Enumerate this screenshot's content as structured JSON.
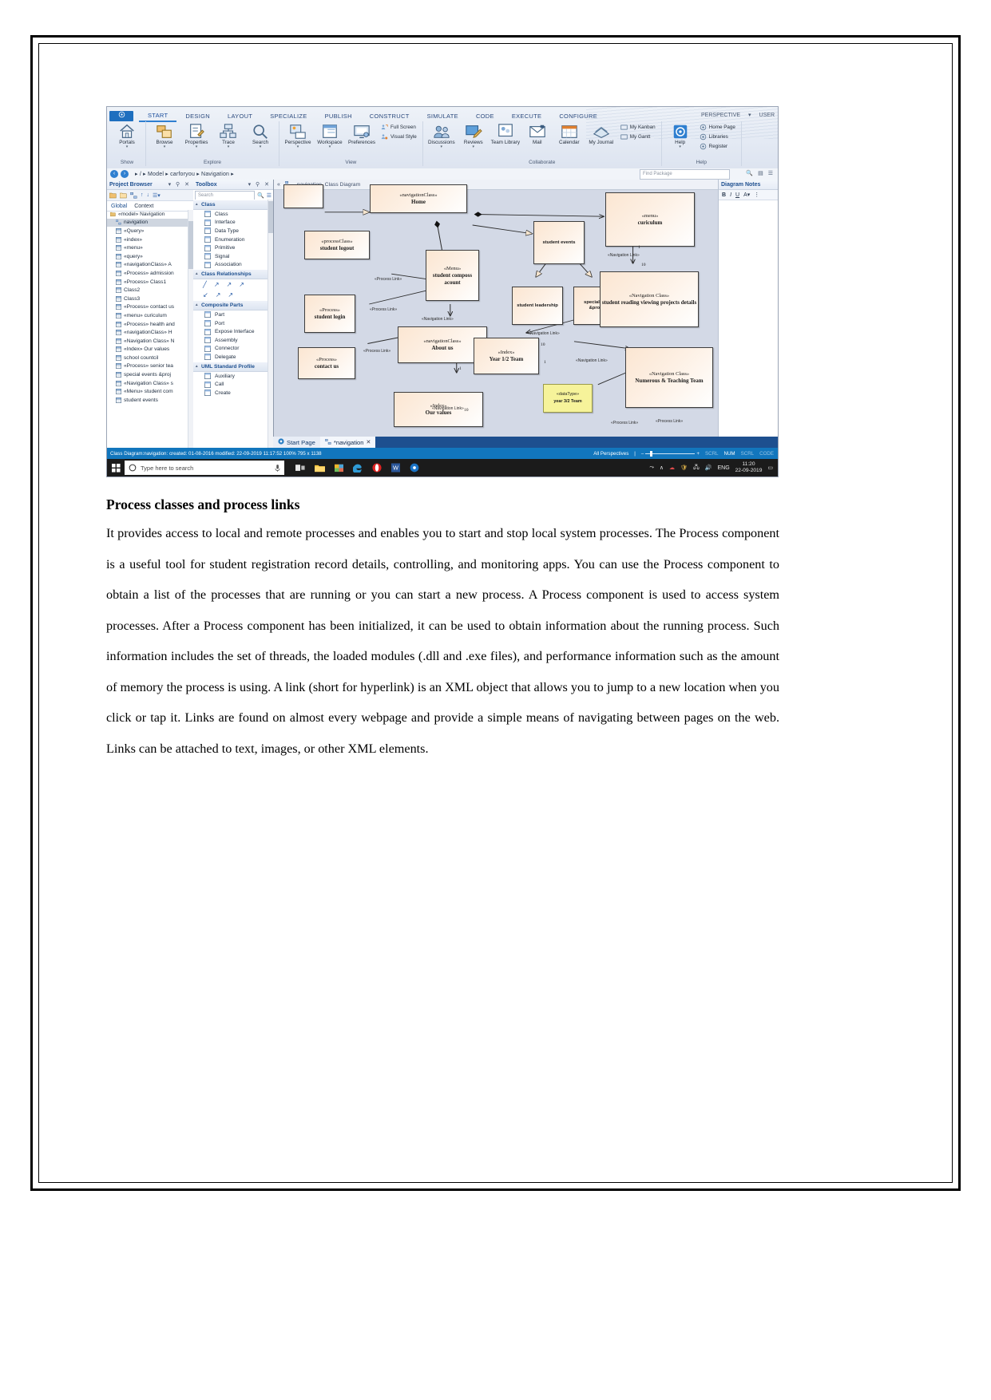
{
  "app": {
    "quick_access": "app-menu",
    "tabs": [
      "START",
      "DESIGN",
      "LAYOUT",
      "SPECIALIZE",
      "PUBLISH",
      "CONSTRUCT",
      "SIMULATE",
      "CODE",
      "EXECUTE",
      "CONFIGURE"
    ],
    "active_tab": "START",
    "perspective": "PERSPECTIVE",
    "user": "USER",
    "ribbon_groups": [
      {
        "label": "Show",
        "big": [
          {
            "text": "Portals",
            "icon": "home-icon",
            "caret": true
          }
        ],
        "small": []
      },
      {
        "label": "Explore",
        "big": [
          {
            "text": "Browse",
            "icon": "browse-icon",
            "caret": true
          },
          {
            "text": "Properties",
            "icon": "properties-icon",
            "caret": true
          },
          {
            "text": "Trace",
            "icon": "trace-icon",
            "caret": true
          },
          {
            "text": "Search",
            "icon": "search-icon",
            "caret": true
          }
        ],
        "small": []
      },
      {
        "label": "View",
        "big": [
          {
            "text": "Perspective",
            "icon": "perspective-icon",
            "caret": true
          },
          {
            "text": "Workspace",
            "icon": "workspace-icon",
            "caret": true
          },
          {
            "text": "Preferences",
            "icon": "preferences-icon",
            "caret": false
          }
        ],
        "small": [
          {
            "text": "Full Screen",
            "icon": "full-screen-icon"
          },
          {
            "text": "Visual Style",
            "icon": "visual-style-icon"
          }
        ]
      },
      {
        "label": "Collaborate",
        "big": [
          {
            "text": "Discussions",
            "icon": "discussions-icon",
            "caret": true
          },
          {
            "text": "Reviews",
            "icon": "reviews-icon",
            "caret": true
          },
          {
            "text": "Team Library",
            "icon": "team-library-icon",
            "caret": false
          },
          {
            "text": "Mail",
            "icon": "mail-icon",
            "caret": false
          },
          {
            "text": "Calendar",
            "icon": "calendar-icon",
            "caret": false
          },
          {
            "text": "My Journal",
            "icon": "journal-icon",
            "caret": false
          }
        ],
        "small": [
          {
            "text": "My Kanban",
            "icon": "kanban-icon"
          },
          {
            "text": "My Gantt",
            "icon": "gantt-icon"
          }
        ]
      },
      {
        "label": "Help",
        "big": [
          {
            "text": "Help",
            "icon": "help-icon",
            "caret": true
          }
        ],
        "small": [
          {
            "text": "Home Page",
            "icon": "home-page-icon"
          },
          {
            "text": "Libraries",
            "icon": "libraries-icon"
          },
          {
            "text": "Register",
            "icon": "register-icon"
          }
        ]
      }
    ],
    "breadcrumb": "▸  /  ▸  Model  ▸  carforyou  ▸  Navigation  ▸",
    "find_package_placeholder": "Find Package"
  },
  "project_browser": {
    "title": "Project Browser",
    "tabs": [
      "Global",
      "Context"
    ],
    "active_tab": "Global",
    "tree": [
      {
        "label": "«model» Navigation",
        "icon": "package-icon",
        "level": 0,
        "selected": false
      },
      {
        "label": "navigation",
        "icon": "diagram-icon",
        "level": 1,
        "selected": true
      },
      {
        "label": "«Query»",
        "icon": "class-icon",
        "level": 1,
        "selected": false
      },
      {
        "label": "«index»",
        "icon": "class-icon",
        "level": 1,
        "selected": false
      },
      {
        "label": "«menu»",
        "icon": "class-icon",
        "level": 1,
        "selected": false
      },
      {
        "label": "«query»",
        "icon": "class-icon",
        "level": 1,
        "selected": false
      },
      {
        "label": "«navigationClass» A",
        "icon": "class-icon",
        "level": 1,
        "selected": false
      },
      {
        "label": "«Process» admission",
        "icon": "class-icon",
        "level": 1,
        "selected": false
      },
      {
        "label": "«Process» Class1",
        "icon": "class-icon",
        "level": 1,
        "selected": false
      },
      {
        "label": "Class2",
        "icon": "class-icon",
        "level": 1,
        "selected": false
      },
      {
        "label": "Class3",
        "icon": "class-icon",
        "level": 1,
        "selected": false
      },
      {
        "label": "«Process» contact us",
        "icon": "class-icon",
        "level": 1,
        "selected": false
      },
      {
        "label": "«menu» curiculum",
        "icon": "class-icon",
        "level": 1,
        "selected": false
      },
      {
        "label": "«Process» health and",
        "icon": "class-icon",
        "level": 1,
        "selected": false
      },
      {
        "label": "«navigationClass» H",
        "icon": "class-icon",
        "level": 1,
        "selected": false
      },
      {
        "label": "«Navigation Class» N",
        "icon": "class-icon",
        "level": 1,
        "selected": false
      },
      {
        "label": "«Index» Our values",
        "icon": "class-icon",
        "level": 1,
        "selected": false
      },
      {
        "label": "school countcil",
        "icon": "class-icon",
        "level": 1,
        "selected": false
      },
      {
        "label": "«Process» senior tea",
        "icon": "class-icon",
        "level": 1,
        "selected": false
      },
      {
        "label": "special events &proj",
        "icon": "class-icon",
        "level": 1,
        "selected": false
      },
      {
        "label": "«Navigation Class» s",
        "icon": "class-icon",
        "level": 1,
        "selected": false
      },
      {
        "label": "«Menu» student com",
        "icon": "class-icon",
        "level": 1,
        "selected": false
      },
      {
        "label": "student events",
        "icon": "class-icon",
        "level": 1,
        "selected": false
      }
    ]
  },
  "toolbox": {
    "title": "Toolbox",
    "search_placeholder": "Search",
    "groups": [
      {
        "name": "Class",
        "items": [
          {
            "label": "Class",
            "icon": "class-icon"
          },
          {
            "label": "Interface",
            "icon": "interface-icon"
          },
          {
            "label": "Data Type",
            "icon": "data-type-icon"
          },
          {
            "label": "Enumeration",
            "icon": "enumeration-icon"
          },
          {
            "label": "Primitive",
            "icon": "primitive-icon"
          },
          {
            "label": "Signal",
            "icon": "signal-icon"
          },
          {
            "label": "Association",
            "icon": "association-icon"
          }
        ]
      },
      {
        "name": "Class Relationships",
        "relationship_icons": [
          "associate-icon",
          "generalize-icon",
          "realize-icon",
          "dependency-icon",
          "nesting-icon",
          "aggregate-icon",
          "compose-icon"
        ],
        "items": []
      },
      {
        "name": "Composite Parts",
        "items": [
          {
            "label": "Part",
            "icon": "part-icon"
          },
          {
            "label": "Port",
            "icon": "port-icon"
          },
          {
            "label": "Expose Interface",
            "icon": "expose-interface-icon"
          },
          {
            "label": "Assembly",
            "icon": "assembly-icon"
          },
          {
            "label": "Connector",
            "icon": "connector-icon"
          },
          {
            "label": "Delegate",
            "icon": "delegate-icon"
          }
        ]
      },
      {
        "name": "UML Standard Profile",
        "items": [
          {
            "label": "Auxiliary",
            "icon": "auxiliary-icon"
          },
          {
            "label": "Call",
            "icon": "call-icon"
          },
          {
            "label": "Create",
            "icon": "create-icon"
          }
        ]
      }
    ]
  },
  "canvas": {
    "header": "navigation.  Class Diagram",
    "nodes": [
      {
        "id": "n-top-left",
        "stereotype": "",
        "name": "",
        "style": "plain"
      },
      {
        "id": "n-home",
        "stereotype": "«navigationClass»",
        "name": "Home",
        "style": "serif"
      },
      {
        "id": "n-logout",
        "stereotype": "«processClass»",
        "name": "student logout",
        "style": "serif"
      },
      {
        "id": "n-compose",
        "stereotype": "«Menu»",
        "name": "student composs acount",
        "style": "serif"
      },
      {
        "id": "n-login",
        "stereotype": "«Process»",
        "name": "student login",
        "style": "serif"
      },
      {
        "id": "n-contact",
        "stereotype": "«Process»",
        "name": "contact us",
        "style": "serif"
      },
      {
        "id": "n-about",
        "stereotype": "«navigationClass»",
        "name": "About us",
        "style": "serif"
      },
      {
        "id": "n-values",
        "stereotype": "«Index»",
        "name": "Our values",
        "style": "serif"
      },
      {
        "id": "n-events",
        "stereotype": "",
        "name": "student events",
        "style": "plain"
      },
      {
        "id": "n-leadership",
        "stereotype": "",
        "name": "student leadership",
        "style": "plain"
      },
      {
        "id": "n-special",
        "stereotype": "",
        "name": "special events &projects",
        "style": "plain"
      },
      {
        "id": "n-curiculum",
        "stereotype": "«menu»",
        "name": "curiculum",
        "style": "serif"
      },
      {
        "id": "n-reading",
        "stereotype": "«Navigation Class»",
        "name": "student reading viewing projects details",
        "style": "serif"
      },
      {
        "id": "n-team",
        "stereotype": "«Index»",
        "name": "Year 1/2 Team",
        "style": "serif"
      },
      {
        "id": "n-numerous",
        "stereotype": "«Navigation Class»",
        "name": "Numerous & Teaching Team",
        "style": "serif"
      },
      {
        "id": "n-datatype",
        "stereotype": "«dataType»",
        "name": "year 3/2 Team",
        "style": "note"
      }
    ],
    "edge_labels": [
      "«Process Link»",
      "«Process Link»",
      "«Process Link»",
      "«Process Link»",
      "«Process Link»",
      "«Navigation Link»",
      "«Navigation Link»",
      "«Navigation Link»",
      "«Navigation Link»",
      "«Navigation Link»",
      "«Navigation Link»"
    ],
    "multiplicities": [
      "1",
      "10",
      "1",
      "10",
      "1",
      "10",
      "1",
      "10"
    ]
  },
  "notes_panel": {
    "title": "Diagram Notes"
  },
  "doc_tabs": [
    {
      "label": "Start Page",
      "icon": "start-page-icon",
      "active": false,
      "closable": false
    },
    {
      "label": "*navigation",
      "icon": "diagram-icon",
      "active": true,
      "closable": true
    }
  ],
  "status_bar": {
    "text": "Class Diagram:navigation:  created: 01-08-2016  modified: 22-09-2019 11:17:52   100%   795 x 1138",
    "perspective": "All Perspectives",
    "zoom_out": "–",
    "zoom_in": "+",
    "indicators": [
      "SCRL",
      "NUM",
      "SCRL",
      "CODE"
    ]
  },
  "taskbar": {
    "search_placeholder": "Type here to search",
    "apps": [
      "task-view-icon",
      "file-explorer-icon",
      "store-icon",
      "edge-icon",
      "opera-icon",
      "word-icon",
      "ea-icon"
    ],
    "language": "ENG",
    "time": "11:20",
    "date": "22-09-2019"
  },
  "document": {
    "heading": "Process classes and process links",
    "body": "It provides access to local and remote processes and enables you to start and stop local system processes. The Process component is a useful tool for student registration record details, controlling, and monitoring apps. You can use the Process component to obtain a list of the processes that are running or you can start a new process. A Process component is used to access system processes. After a Process component has been initialized, it can be used to obtain information about the running process. Such information includes the set of threads, the loaded modules (.dll and .exe files), and performance information such as the amount of memory the process is using. A link (short for hyperlink) is an XML object that allows you to jump to a new location when you click or tap it. Links are found on almost every webpage and provide a simple means of navigating between pages on the web. Links can be attached to text, images, or other XML elements."
  }
}
